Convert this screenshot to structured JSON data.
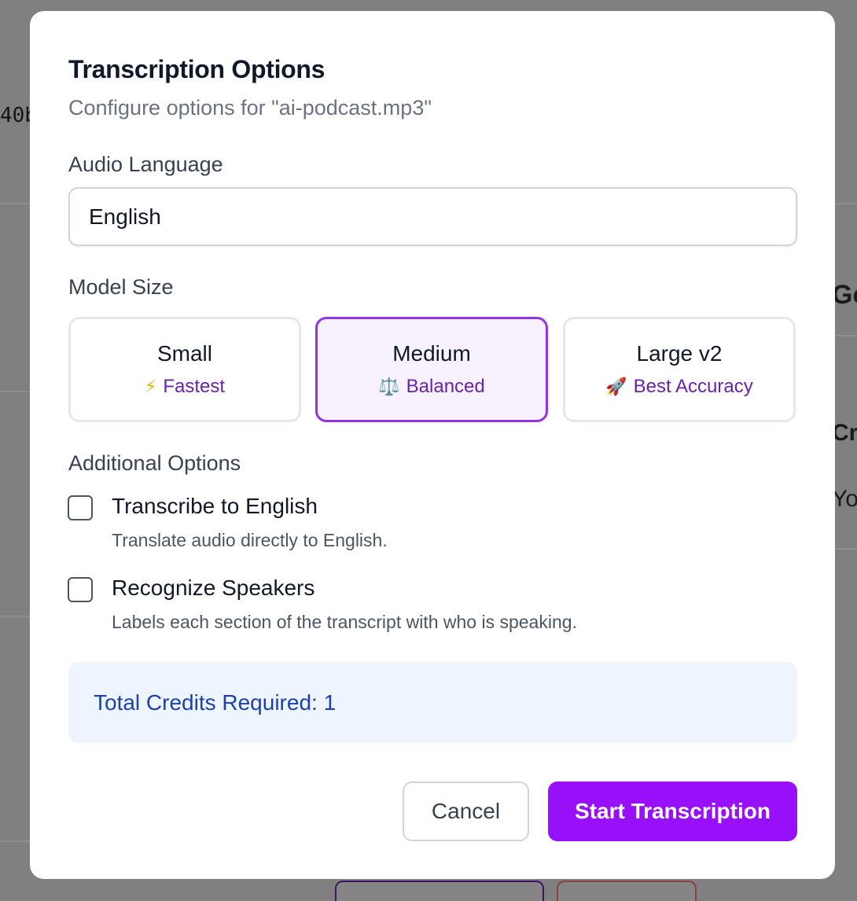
{
  "background": {
    "hash_fragment": "40b",
    "right_fragments": [
      "Go",
      "Cre",
      "You"
    ]
  },
  "modal": {
    "title": "Transcription Options",
    "subtitle": "Configure options for \"ai-podcast.mp3\"",
    "language": {
      "label": "Audio Language",
      "value": "English"
    },
    "model_size": {
      "label": "Model Size",
      "options": [
        {
          "name": "Small",
          "icon": "⚡",
          "icon_name": "lightning-icon",
          "description": "Fastest",
          "selected": false
        },
        {
          "name": "Medium",
          "icon": "⚖️",
          "icon_name": "balance-scale-icon",
          "description": "Balanced",
          "selected": true
        },
        {
          "name": "Large v2",
          "icon": "🚀",
          "icon_name": "rocket-icon",
          "description": "Best Accuracy",
          "selected": false
        }
      ]
    },
    "additional_options": {
      "label": "Additional Options",
      "items": [
        {
          "title": "Transcribe to English",
          "description": "Translate audio directly to English.",
          "checked": false
        },
        {
          "title": "Recognize Speakers",
          "description": "Labels each section of the transcript with who is speaking.",
          "checked": false
        }
      ]
    },
    "credits_text": "Total Credits Required: 1",
    "cancel_label": "Cancel",
    "start_label": "Start Transcription"
  },
  "colors": {
    "accent": "#9810fa",
    "selected_border": "#9333ea",
    "credits_bg": "#eef5ff",
    "credits_text": "#1e40af"
  }
}
